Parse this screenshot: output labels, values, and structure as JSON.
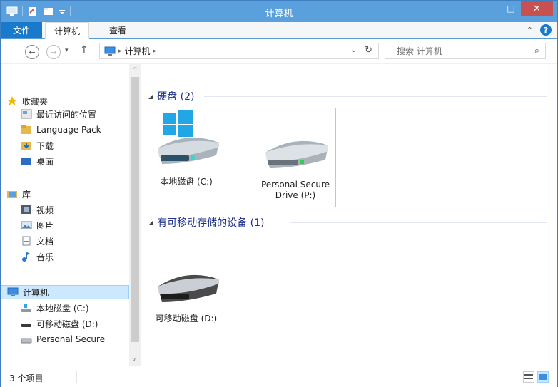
{
  "window": {
    "title": "计算机",
    "minimize_glyph": "–",
    "maximize_glyph": "□",
    "close_glyph": "✕"
  },
  "ribbon": {
    "tabs": [
      {
        "label": "文件"
      },
      {
        "label": "计算机"
      },
      {
        "label": "查看"
      }
    ],
    "collapse_glyph": "^",
    "help_glyph": "?"
  },
  "address": {
    "back_glyph": "←",
    "forward_glyph": "→",
    "recent_glyph": "▾",
    "up_glyph": "↑",
    "sep1": "▸",
    "path": [
      "计算机"
    ],
    "sep2": "▸",
    "dropdown_glyph": "⌄",
    "refresh_glyph": "↻"
  },
  "search": {
    "placeholder": "搜索 计算机",
    "icon_glyph": "⌕"
  },
  "sidebar": {
    "favorites_label": "收藏夹",
    "favorites": [
      {
        "label": "最近访问的位置"
      },
      {
        "label": "Language Pack"
      },
      {
        "label": "下载"
      },
      {
        "label": "桌面"
      }
    ],
    "libraries_label": "库",
    "libraries": [
      {
        "label": "视频"
      },
      {
        "label": "图片"
      },
      {
        "label": "文档"
      },
      {
        "label": "音乐"
      }
    ],
    "computer_label": "计算机",
    "drives": [
      {
        "label": "本地磁盘 (C:)"
      },
      {
        "label": "可移动磁盘 (D:)"
      },
      {
        "label": "Personal Secure"
      }
    ],
    "scroll_up": "^",
    "scroll_down": "v"
  },
  "main": {
    "groups": [
      {
        "title": "硬盘 (2)",
        "drives": [
          {
            "label": "本地磁盘 (C:)"
          },
          {
            "label_line1": "Personal Secure",
            "label_line2": "Drive (P:)"
          }
        ]
      },
      {
        "title": "有可移动存储的设备 (1)",
        "drives": [
          {
            "label": "可移动磁盘 (D:)"
          }
        ]
      }
    ],
    "group_toggle_glyph": "◢"
  },
  "status": {
    "count": "3 个项目"
  },
  "colors": {
    "titlebar": "#5aa0dc",
    "file_tab": "#1979ca",
    "close": "#c75050",
    "group_head": "#1e3287",
    "selection": "#cce8ff"
  }
}
